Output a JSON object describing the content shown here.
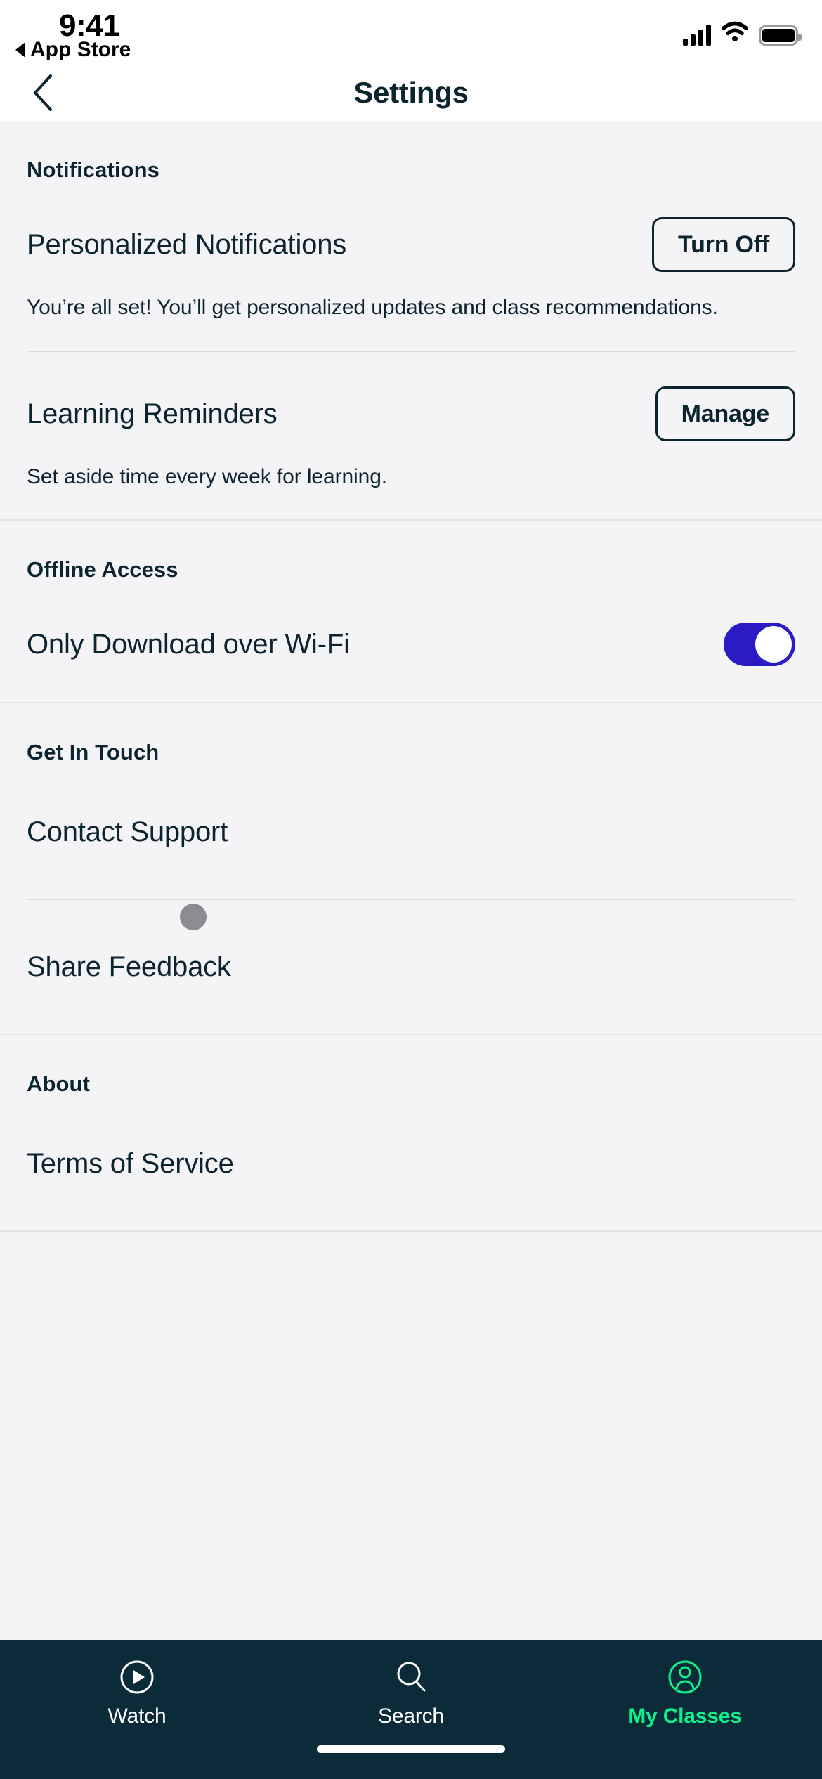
{
  "status_bar": {
    "time": "9:41",
    "back_app": "App Store",
    "icons": [
      "cellular-signal-icon",
      "wifi-icon",
      "battery-icon"
    ]
  },
  "navbar": {
    "title": "Settings",
    "back_icon": "chevron-left-icon"
  },
  "colors": {
    "page_background": "#f4f3f6",
    "nav_background": "#ffffff",
    "text_primary": "#0b2430",
    "toggle_on": "#2a1bc4",
    "tabbar_background": "#0b2b39",
    "tab_active": "#0df08c",
    "divider": "#e3e2e7"
  },
  "sections": [
    {
      "title": "Notifications",
      "rows": [
        {
          "label": "Personalized Notifications",
          "action_label": "Turn Off",
          "help": "You’re all set! You’ll get personalized updates and class recommendations."
        },
        {
          "label": "Learning Reminders",
          "action_label": "Manage",
          "help": "Set aside time every week for learning."
        }
      ]
    },
    {
      "title": "Offline Access",
      "toggle_row": {
        "label": "Only Download over Wi-Fi",
        "state": "on"
      }
    },
    {
      "title": "Get In Touch",
      "links": [
        {
          "label": "Contact Support"
        },
        {
          "label": "Share Feedback"
        }
      ]
    },
    {
      "title": "About",
      "links": [
        {
          "label": "Terms of Service"
        }
      ]
    }
  ],
  "tabbar": {
    "tabs": [
      {
        "label": "Watch",
        "icon": "play-circle-icon",
        "active": false
      },
      {
        "label": "Search",
        "icon": "search-icon",
        "active": false
      },
      {
        "label": "My Classes",
        "icon": "person-circle-icon",
        "active": true
      }
    ]
  }
}
